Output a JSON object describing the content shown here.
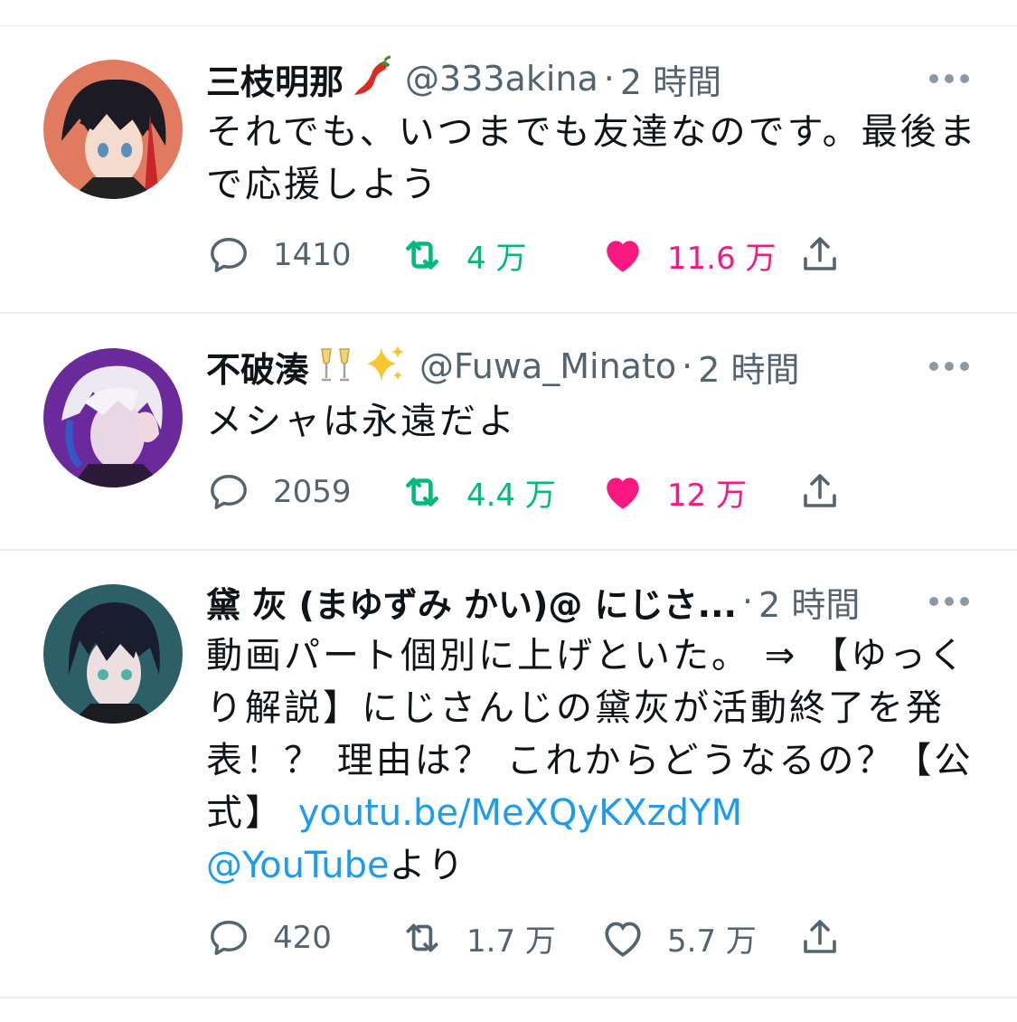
{
  "tweets": [
    {
      "name": "三枝明那",
      "name_emoji": "chili-pepper",
      "handle": "@333akina",
      "separator": "·",
      "time": "2 時間",
      "text": "それでも、いつまでも友達なのです。最後まで応援しよう",
      "replies": "1410",
      "retweets": "4 万",
      "likes": "11.6 万",
      "liked": true,
      "retweeted": true,
      "avatar_bg": "#e07b5f"
    },
    {
      "name": "不破湊",
      "name_emoji": "champagne-glasses sparkles",
      "handle": "@Fuwa_Minato",
      "separator": "·",
      "time": "2 時間",
      "text": "メシャは永遠だよ",
      "replies": "2059",
      "retweets": "4.4 万",
      "likes": "12 万",
      "liked": true,
      "retweeted": true,
      "avatar_bg": "#6b2a9c"
    },
    {
      "name": "黛 灰 (まゆずみ かい)@ にじさ...",
      "handle": "",
      "separator": "·",
      "time": "2 時間",
      "text_before": "動画パート個別に上げといた。 ⇒ 【ゆっくり解説】にじさんじの黛灰が活動終了を発表！？ 理由は？ これからどうなるの？【公式】 ",
      "link_url": "youtu.be/MeXQyKXzdYM",
      "link_mention": "@YouTube",
      "text_after": "より",
      "replies": "420",
      "retweets": "1.7 万",
      "likes": "5.7 万",
      "liked": false,
      "retweeted": false,
      "avatar_bg": "#2d5f66"
    }
  ],
  "colors": {
    "text": "#0f1419",
    "secondary": "#536471",
    "retweet_green": "#00ba7c",
    "like_pink": "#f91880",
    "link_blue": "#1d9bf0",
    "divider": "#eceff1"
  },
  "icons": {
    "reply": "speech-bubble-icon",
    "retweet": "retweet-arrows-icon",
    "like": "heart-icon",
    "share": "share-upload-icon",
    "more": "more-dots-icon"
  }
}
